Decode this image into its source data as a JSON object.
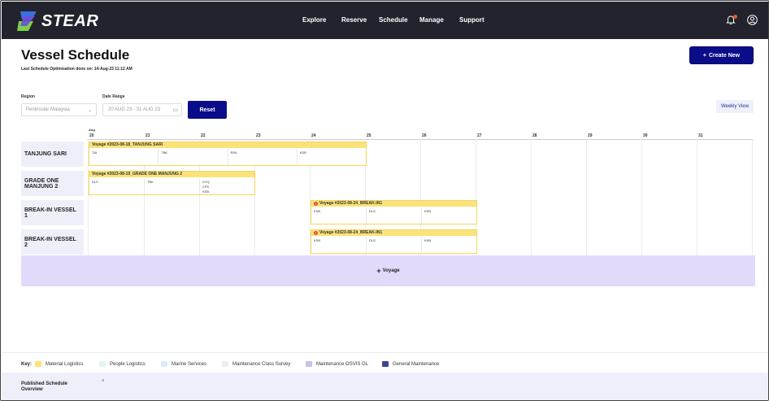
{
  "app": {
    "brand": "STEAR",
    "nav": [
      "Explore",
      "Reserve",
      "Schedule",
      "Manage",
      "Support"
    ],
    "notification_dot_color": "#e7572b"
  },
  "header": {
    "title": "Vessel Schedule",
    "subtitle": "Last Schedule Optimisation done on: 14-Aug-23 11:12 AM",
    "create_label": "Create New"
  },
  "filters": {
    "region_label": "Region",
    "region_value": "Peninsular Malaysia",
    "date_label": "Date Range",
    "date_value": "20 AUG 23 - 31 AUG 23",
    "reset_label": "Reset",
    "view_label": "Weekly View"
  },
  "schedule": {
    "month": "Aug",
    "days": [
      "20",
      "21",
      "22",
      "23",
      "24",
      "25",
      "26",
      "27",
      "28",
      "29",
      "30",
      "31"
    ],
    "vessels": [
      {
        "name": "TANJUNG SARI",
        "voyage": {
          "title": "Voyage #2023-08-18_TANJUNG SARI",
          "error": false,
          "ports": [
            "TIA",
            "TBK",
            "RSK",
            "KSB"
          ]
        }
      },
      {
        "name": "GRADE ONE MANJUNG 2",
        "voyage": {
          "title": "Voyage #2023-08-19_GRADE ONE MANJUNG 2",
          "error": false,
          "ports": [
            "DLS",
            "TBK",
            "DYQ\nCPD\nKSB"
          ]
        }
      },
      {
        "name": "BREAK-IN VESSEL 1",
        "voyage": {
          "title": "Voyage #2023-08-24_BREAK-IN1",
          "error": true,
          "ports": [
            "KSB",
            "DLS",
            "KSB"
          ]
        }
      },
      {
        "name": "BREAK-IN VESSEL 2",
        "voyage": {
          "title": "Voyage #2023-08-24_BREAK-IN1",
          "error": true,
          "ports": [
            "KSB",
            "DLS",
            "KSB"
          ]
        }
      }
    ],
    "add_voyage_label": "Voyage"
  },
  "key": {
    "label": "Key:",
    "items": [
      {
        "label": "Material Logistics",
        "color": "#fbe27a"
      },
      {
        "label": "People Logistics",
        "color": "#dff5ee"
      },
      {
        "label": "Marine Services",
        "color": "#d9ecfb"
      },
      {
        "label": "Maintenance Class Survey",
        "color": "#ededed"
      },
      {
        "label": "Maintenance OSVIS GL",
        "color": "#c9c2e8"
      },
      {
        "label": "General Maintenance",
        "color": "#3d4596"
      }
    ]
  },
  "bottom": {
    "title": "Published Schedule Overview"
  }
}
